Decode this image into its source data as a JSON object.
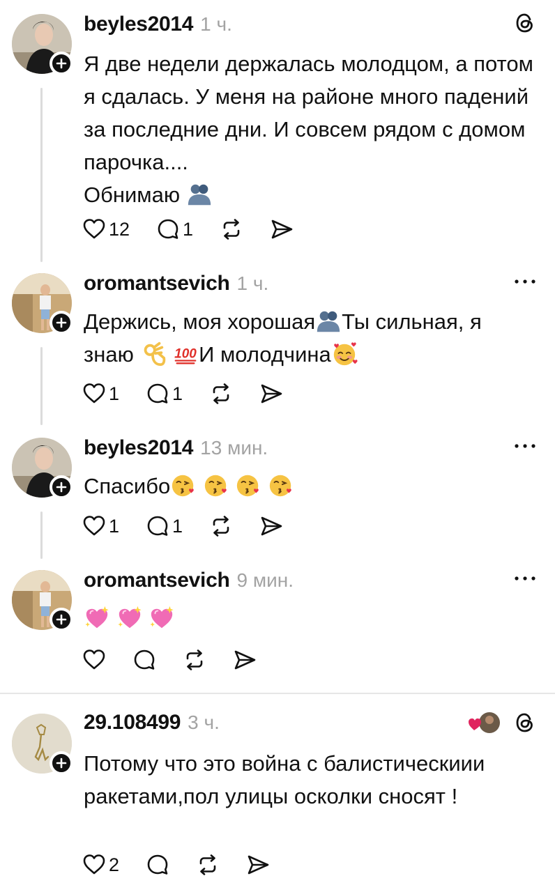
{
  "colors": {
    "text": "#111111",
    "muted": "#a3a3a3",
    "thread_line": "#dcdcdc",
    "heart": "#e0245e"
  },
  "posts": [
    {
      "username": "beyles2014",
      "time": "1 ч.",
      "text_parts": [
        "Я две недели держалась молодцом, а потом я сдалась. У меня на районе много падений за последние дни. И совсем рядом с домом парочка....",
        "Обнимаю"
      ],
      "emoji": [
        "hugging-people-emoji"
      ],
      "likes": "12",
      "replies": "1",
      "corner_icon": "threads-logo-icon"
    },
    {
      "username": "oromantsevich",
      "time": "1 ч.",
      "text_parts": [
        "Держись, моя хорошая",
        "Ты сильная, я знаю",
        "И молодчина"
      ],
      "emoji": [
        "hugging-people-emoji",
        "ok-hand-emoji",
        "hundred-points-emoji",
        "smiling-face-with-hearts-emoji"
      ],
      "likes": "1",
      "replies": "1",
      "corner_icon": "more-icon"
    },
    {
      "username": "beyles2014",
      "time": "13 мин.",
      "text_parts": [
        "Спасибо"
      ],
      "emoji": [
        "kissing-face-emoji",
        "kissing-face-emoji",
        "kissing-face-emoji",
        "kissing-face-emoji"
      ],
      "likes": "1",
      "replies": "1",
      "corner_icon": "more-icon"
    },
    {
      "username": "oromantsevich",
      "time": "9 мин.",
      "text_parts": [],
      "emoji": [
        "sparkling-heart-emoji",
        "sparkling-heart-emoji",
        "sparkling-heart-emoji"
      ],
      "likes": "",
      "replies": "",
      "corner_icon": "more-icon"
    },
    {
      "username": "29.108499",
      "time": "3 ч.",
      "text_parts": [
        "Потому что это война с балистическиии ракетами,пол улицы осколки сносят !"
      ],
      "emoji": [],
      "likes": "2",
      "replies": "",
      "corner_icon": "threads-logo-icon"
    }
  ]
}
